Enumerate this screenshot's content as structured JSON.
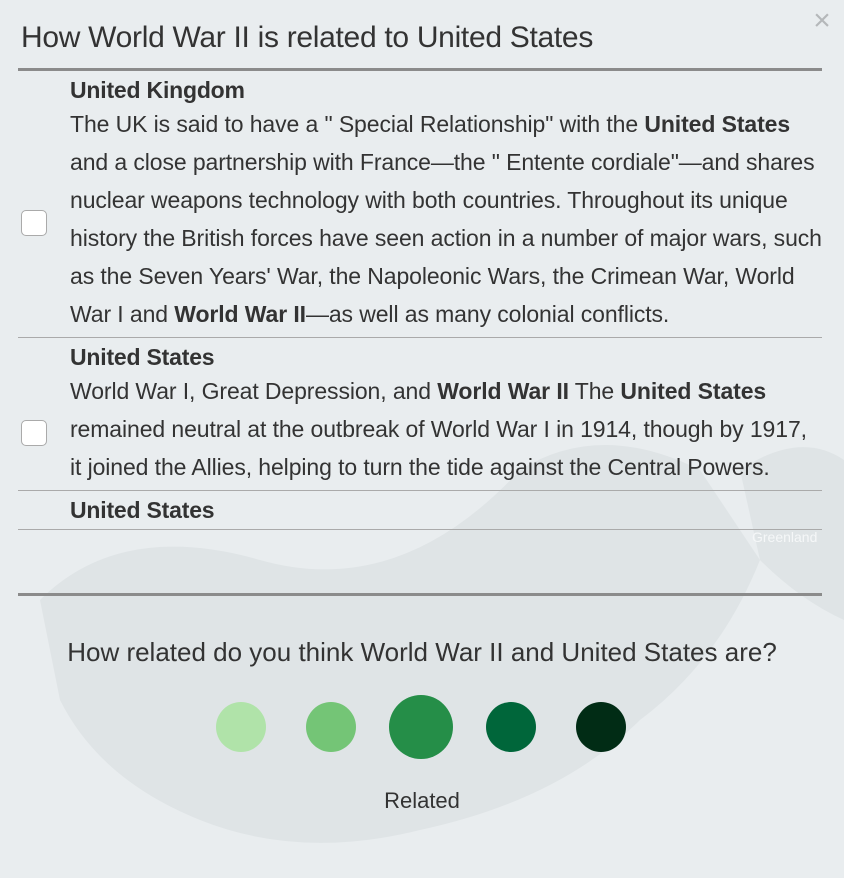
{
  "dialog": {
    "title": "How World War II is related to United States",
    "close_label": "×"
  },
  "items": [
    {
      "title": "United Kingdom",
      "segments": [
        {
          "text": "The UK is said to have a \" Special Relationship\" with the ",
          "bold": false
        },
        {
          "text": "United States",
          "bold": true
        },
        {
          "text": " and a close partnership with France—the \" Entente cordiale\"—and shares nuclear weapons technology with both countries. Throughout its unique history the British forces have seen action in a number of major wars, such as the Seven Years' War, the Napoleonic Wars, the Crimean War, World War I and ",
          "bold": false
        },
        {
          "text": "World War II",
          "bold": true
        },
        {
          "text": "—as well as many colonial conflicts.",
          "bold": false
        }
      ],
      "checked": false
    },
    {
      "title": "United States",
      "segments": [
        {
          "text": "World War I, Great Depression, and ",
          "bold": false
        },
        {
          "text": "World War II",
          "bold": true
        },
        {
          "text": " The ",
          "bold": false
        },
        {
          "text": "United States",
          "bold": true
        },
        {
          "text": " remained neutral at the outbreak of World War I in 1914, though by 1917, it joined the Allies, helping to turn the tide against the Central Powers.",
          "bold": false
        }
      ],
      "checked": false
    },
    {
      "title": "United States",
      "segments": [],
      "checked": false
    }
  ],
  "rating": {
    "question": "How related do you think World War II and United States are?",
    "selected_label": "Related",
    "selected_index": 2,
    "options": [
      {
        "color": "#b0e3a9"
      },
      {
        "color": "#74c576"
      },
      {
        "color": "#258e48"
      },
      {
        "color": "#00663a"
      },
      {
        "color": "#012c15"
      }
    ]
  },
  "map": {
    "labels": [
      "Greenland"
    ]
  }
}
